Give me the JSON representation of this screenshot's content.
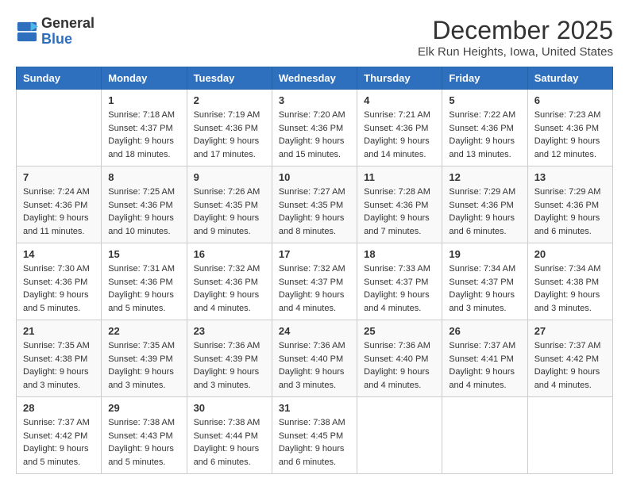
{
  "header": {
    "logo_general": "General",
    "logo_blue": "Blue",
    "month_title": "December 2025",
    "location": "Elk Run Heights, Iowa, United States"
  },
  "weekdays": [
    "Sunday",
    "Monday",
    "Tuesday",
    "Wednesday",
    "Thursday",
    "Friday",
    "Saturday"
  ],
  "weeks": [
    [
      {
        "day": "",
        "sunrise": "",
        "sunset": "",
        "daylight": ""
      },
      {
        "day": "1",
        "sunrise": "Sunrise: 7:18 AM",
        "sunset": "Sunset: 4:37 PM",
        "daylight": "Daylight: 9 hours and 18 minutes."
      },
      {
        "day": "2",
        "sunrise": "Sunrise: 7:19 AM",
        "sunset": "Sunset: 4:36 PM",
        "daylight": "Daylight: 9 hours and 17 minutes."
      },
      {
        "day": "3",
        "sunrise": "Sunrise: 7:20 AM",
        "sunset": "Sunset: 4:36 PM",
        "daylight": "Daylight: 9 hours and 15 minutes."
      },
      {
        "day": "4",
        "sunrise": "Sunrise: 7:21 AM",
        "sunset": "Sunset: 4:36 PM",
        "daylight": "Daylight: 9 hours and 14 minutes."
      },
      {
        "day": "5",
        "sunrise": "Sunrise: 7:22 AM",
        "sunset": "Sunset: 4:36 PM",
        "daylight": "Daylight: 9 hours and 13 minutes."
      },
      {
        "day": "6",
        "sunrise": "Sunrise: 7:23 AM",
        "sunset": "Sunset: 4:36 PM",
        "daylight": "Daylight: 9 hours and 12 minutes."
      }
    ],
    [
      {
        "day": "7",
        "sunrise": "Sunrise: 7:24 AM",
        "sunset": "Sunset: 4:36 PM",
        "daylight": "Daylight: 9 hours and 11 minutes."
      },
      {
        "day": "8",
        "sunrise": "Sunrise: 7:25 AM",
        "sunset": "Sunset: 4:36 PM",
        "daylight": "Daylight: 9 hours and 10 minutes."
      },
      {
        "day": "9",
        "sunrise": "Sunrise: 7:26 AM",
        "sunset": "Sunset: 4:35 PM",
        "daylight": "Daylight: 9 hours and 9 minutes."
      },
      {
        "day": "10",
        "sunrise": "Sunrise: 7:27 AM",
        "sunset": "Sunset: 4:35 PM",
        "daylight": "Daylight: 9 hours and 8 minutes."
      },
      {
        "day": "11",
        "sunrise": "Sunrise: 7:28 AM",
        "sunset": "Sunset: 4:36 PM",
        "daylight": "Daylight: 9 hours and 7 minutes."
      },
      {
        "day": "12",
        "sunrise": "Sunrise: 7:29 AM",
        "sunset": "Sunset: 4:36 PM",
        "daylight": "Daylight: 9 hours and 6 minutes."
      },
      {
        "day": "13",
        "sunrise": "Sunrise: 7:29 AM",
        "sunset": "Sunset: 4:36 PM",
        "daylight": "Daylight: 9 hours and 6 minutes."
      }
    ],
    [
      {
        "day": "14",
        "sunrise": "Sunrise: 7:30 AM",
        "sunset": "Sunset: 4:36 PM",
        "daylight": "Daylight: 9 hours and 5 minutes."
      },
      {
        "day": "15",
        "sunrise": "Sunrise: 7:31 AM",
        "sunset": "Sunset: 4:36 PM",
        "daylight": "Daylight: 9 hours and 5 minutes."
      },
      {
        "day": "16",
        "sunrise": "Sunrise: 7:32 AM",
        "sunset": "Sunset: 4:36 PM",
        "daylight": "Daylight: 9 hours and 4 minutes."
      },
      {
        "day": "17",
        "sunrise": "Sunrise: 7:32 AM",
        "sunset": "Sunset: 4:37 PM",
        "daylight": "Daylight: 9 hours and 4 minutes."
      },
      {
        "day": "18",
        "sunrise": "Sunrise: 7:33 AM",
        "sunset": "Sunset: 4:37 PM",
        "daylight": "Daylight: 9 hours and 4 minutes."
      },
      {
        "day": "19",
        "sunrise": "Sunrise: 7:34 AM",
        "sunset": "Sunset: 4:37 PM",
        "daylight": "Daylight: 9 hours and 3 minutes."
      },
      {
        "day": "20",
        "sunrise": "Sunrise: 7:34 AM",
        "sunset": "Sunset: 4:38 PM",
        "daylight": "Daylight: 9 hours and 3 minutes."
      }
    ],
    [
      {
        "day": "21",
        "sunrise": "Sunrise: 7:35 AM",
        "sunset": "Sunset: 4:38 PM",
        "daylight": "Daylight: 9 hours and 3 minutes."
      },
      {
        "day": "22",
        "sunrise": "Sunrise: 7:35 AM",
        "sunset": "Sunset: 4:39 PM",
        "daylight": "Daylight: 9 hours and 3 minutes."
      },
      {
        "day": "23",
        "sunrise": "Sunrise: 7:36 AM",
        "sunset": "Sunset: 4:39 PM",
        "daylight": "Daylight: 9 hours and 3 minutes."
      },
      {
        "day": "24",
        "sunrise": "Sunrise: 7:36 AM",
        "sunset": "Sunset: 4:40 PM",
        "daylight": "Daylight: 9 hours and 3 minutes."
      },
      {
        "day": "25",
        "sunrise": "Sunrise: 7:36 AM",
        "sunset": "Sunset: 4:40 PM",
        "daylight": "Daylight: 9 hours and 4 minutes."
      },
      {
        "day": "26",
        "sunrise": "Sunrise: 7:37 AM",
        "sunset": "Sunset: 4:41 PM",
        "daylight": "Daylight: 9 hours and 4 minutes."
      },
      {
        "day": "27",
        "sunrise": "Sunrise: 7:37 AM",
        "sunset": "Sunset: 4:42 PM",
        "daylight": "Daylight: 9 hours and 4 minutes."
      }
    ],
    [
      {
        "day": "28",
        "sunrise": "Sunrise: 7:37 AM",
        "sunset": "Sunset: 4:42 PM",
        "daylight": "Daylight: 9 hours and 5 minutes."
      },
      {
        "day": "29",
        "sunrise": "Sunrise: 7:38 AM",
        "sunset": "Sunset: 4:43 PM",
        "daylight": "Daylight: 9 hours and 5 minutes."
      },
      {
        "day": "30",
        "sunrise": "Sunrise: 7:38 AM",
        "sunset": "Sunset: 4:44 PM",
        "daylight": "Daylight: 9 hours and 6 minutes."
      },
      {
        "day": "31",
        "sunrise": "Sunrise: 7:38 AM",
        "sunset": "Sunset: 4:45 PM",
        "daylight": "Daylight: 9 hours and 6 minutes."
      },
      {
        "day": "",
        "sunrise": "",
        "sunset": "",
        "daylight": ""
      },
      {
        "day": "",
        "sunrise": "",
        "sunset": "",
        "daylight": ""
      },
      {
        "day": "",
        "sunrise": "",
        "sunset": "",
        "daylight": ""
      }
    ]
  ]
}
